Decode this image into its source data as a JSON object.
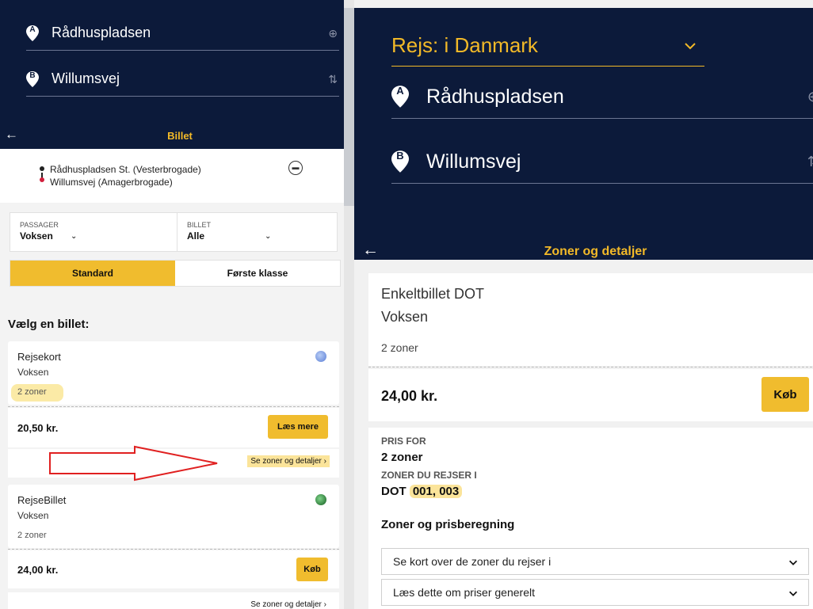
{
  "left": {
    "route": {
      "from": "Rådhuspladsen",
      "to": "Willumsvej",
      "from_pin": "A",
      "to_pin": "B"
    },
    "header_title": "Billet",
    "trip": {
      "from_stop": "Rådhuspladsen St. (Vesterbrogade)",
      "to_stop": "Willumsvej (Amagerbrogade)"
    },
    "passenger": {
      "caption": "PASSAGER",
      "value": "Voksen"
    },
    "ticket": {
      "caption": "BILLET",
      "value": "Alle"
    },
    "tabs": [
      "Standard",
      "Første klasse"
    ],
    "heading": "Vælg en billet:",
    "cards": [
      {
        "name": "Rejsekort",
        "type": "Voksen",
        "zones": "2 zoner",
        "price": "20,50 kr.",
        "button": "Læs mere",
        "link": "Se zoner og detaljer ›",
        "color": "#5b7fd6"
      },
      {
        "name": "RejseBillet",
        "type": "Voksen",
        "zones": "2 zoner",
        "price": "24,00 kr.",
        "button": "Køb",
        "link": "Se zoner og detaljer ›",
        "color": "#1f7a2e"
      }
    ]
  },
  "right": {
    "region": "Rejs: i Danmark",
    "route": {
      "from": "Rådhuspladsen",
      "to": "Willumsvej",
      "from_pin": "A",
      "to_pin": "B"
    },
    "header_title": "Zoner og detaljer",
    "ticket_name": "Enkeltbillet DOT",
    "ticket_type": "Voksen",
    "zones": "2 zoner",
    "price": "24,00 kr.",
    "buy": "Køb",
    "price_for_caption": "PRIS FOR",
    "price_for_value": "2 zoner",
    "zones_caption": "ZONER DU REJSER I",
    "zones_prefix": "DOT",
    "zones_numbers": "001, 003",
    "section_heading": "Zoner og prisberegning",
    "accordions": [
      "Se kort over de zoner du rejser i",
      "Læs dette om priser generelt"
    ]
  },
  "colors": {
    "navy": "#0c1a3a",
    "accent_yellow": "#f0bc2e",
    "highlight": "#fbe49a",
    "arrow_red": "#e02020"
  }
}
